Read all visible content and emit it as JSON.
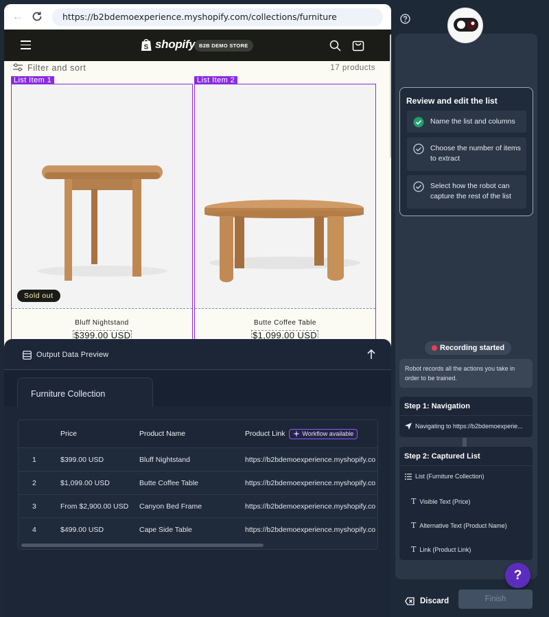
{
  "browser": {
    "url": "https://b2bdemoexperience.myshopify.com/collections/furniture"
  },
  "shop": {
    "brand": "shopify",
    "badge": "B2B DEMO STORE",
    "filter_label": "Filter and sort",
    "product_count": "17 products"
  },
  "list_items": [
    {
      "tag": "List Item 1",
      "name": "Bluff Nightstand",
      "price": "$399.00 USD",
      "badge": "Sold out"
    },
    {
      "tag": "List Item 2",
      "name": "Butte Coffee Table",
      "price": "$1,099.00 USD"
    }
  ],
  "preview": {
    "title": "Output Data Preview",
    "tab": "Furniture Collection",
    "columns": [
      "Price",
      "Product Name",
      "Product Link"
    ],
    "workflow_badge": "Workflow available",
    "rows": [
      {
        "n": "1",
        "price": "$399.00 USD",
        "name": "Bluff Nightstand",
        "link": "https://b2bdemoexperience.myshopify.co"
      },
      {
        "n": "2",
        "price": "$1,099.00 USD",
        "name": "Butte Coffee Table",
        "link": "https://b2bdemoexperience.myshopify.co"
      },
      {
        "n": "3",
        "price": "From $2,900.00 USD",
        "name": "Canyon Bed Frame",
        "link": "https://b2bdemoexperience.myshopify.co"
      },
      {
        "n": "4",
        "price": "$499.00 USD",
        "name": "Cape Side Table",
        "link": "https://b2bdemoexperience.myshopify.co"
      }
    ]
  },
  "sidebar": {
    "steps_title": "Review and edit the list",
    "checklist": [
      {
        "label": "Name the list and columns",
        "done": true
      },
      {
        "label": "Choose the number of items to extract",
        "done": false
      },
      {
        "label": "Select how the robot can capture the rest of the list",
        "done": false
      }
    ],
    "recording_label": "Recording started",
    "recording_note": "Robot records all the actions you take in order to be trained.",
    "step1_title": "Step 1: Navigation",
    "step1_detail": "Navigating to https://b2bdemoexperie...",
    "step2_title": "Step 2: Captured List",
    "step2_items": [
      "List (Furniture Collection)",
      "Visible Text (Price)",
      "Alternative Text (Product Name)",
      "Link (Product Link)"
    ],
    "help_fab": "?",
    "discard_label": "Discard",
    "finish_label": "Finish"
  },
  "colors": {
    "accent_purple": "#8a2be2",
    "panel_bg": "#1c2636",
    "recording_dot": "#ef3b5a",
    "check_green": "#22a06b"
  }
}
